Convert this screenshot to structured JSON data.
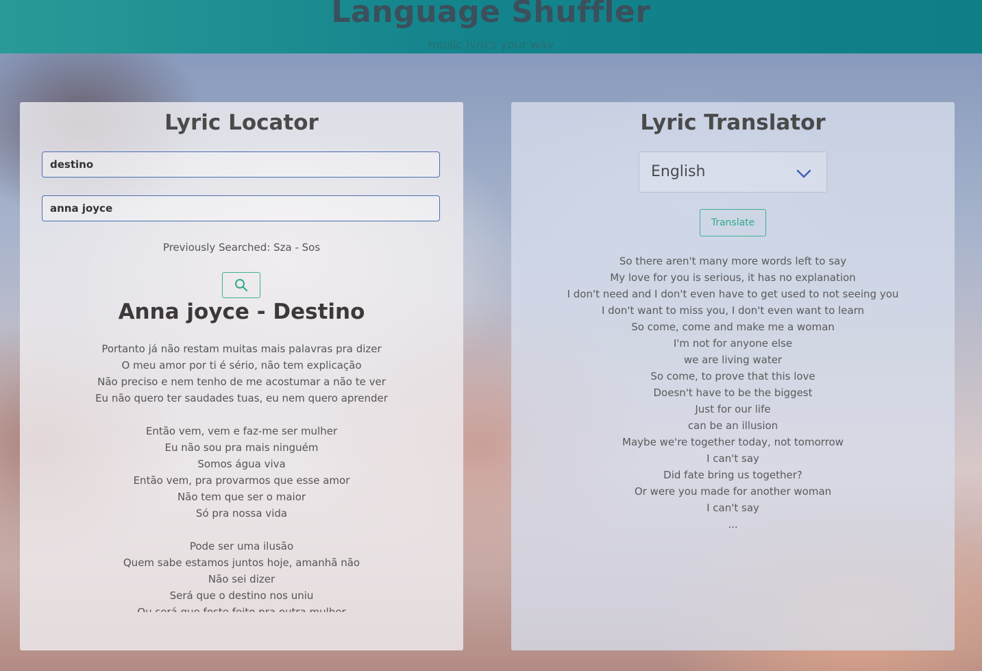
{
  "header": {
    "title": "Language Shuffler",
    "subtitle": "music lyrics your way"
  },
  "locator": {
    "heading": "Lyric Locator",
    "song_input_value": "destino",
    "artist_input_value": "anna joyce",
    "previously_searched": "Previously Searched: Sza - Sos",
    "search_icon": "search-icon",
    "song_title": "Anna joyce - Destino",
    "lyrics": [
      "Portanto já não restam muitas mais palavras pra dizer",
      "O meu amor por ti é sério, não tem explicação",
      "Não preciso e nem tenho de me acostumar a não te ver",
      "Eu não quero ter saudades tuas, eu nem quero aprender",
      "",
      "Então vem, vem e faz-me ser mulher",
      "Eu não sou pra mais ninguém",
      "Somos água viva",
      "Então vem, pra provarmos que esse amor",
      "Não tem que ser o maior",
      "Só pra nossa vida",
      "",
      "Pode ser uma ilusão",
      "Quem sabe estamos juntos hoje, amanhã não",
      "Não sei dizer",
      "Será que o destino nos uniu",
      "Ou será que foste feito pra outra mulher"
    ]
  },
  "translator": {
    "heading": "Lyric Translator",
    "language_selected": "English",
    "translate_label": "Translate",
    "lyrics": [
      "So there aren't many more words left to say",
      "My love for you is serious, it has no explanation",
      "I don't need and I don't even have to get used to not seeing you",
      "I don't want to miss you, I don't even want to learn",
      "So come, come and make me a woman",
      "I'm not for anyone else",
      "we are living water",
      "So come, to prove that this love",
      "Doesn't have to be the biggest",
      "Just for our life",
      "can be an illusion",
      "Maybe we're together today, not tomorrow",
      "I can't say",
      "Did fate bring us together?",
      "Or were you made for another woman",
      "I can't say",
      "..."
    ]
  },
  "colors": {
    "header_bg": "#14858c",
    "accent": "#3fae95",
    "input_border": "#4a6fb0"
  }
}
